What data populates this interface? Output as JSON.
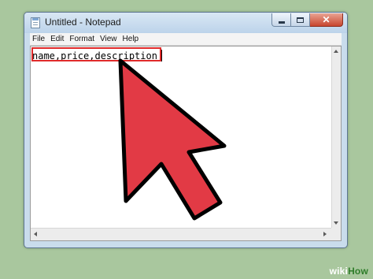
{
  "window": {
    "title": "Untitled - Notepad",
    "close_glyph": "✕"
  },
  "menu": [
    "File",
    "Edit",
    "Format",
    "View",
    "Help"
  ],
  "editor": {
    "content": "name,price,description"
  },
  "icons": {
    "app": "notepad-icon",
    "cursor": "mouse-cursor-arrow-icon"
  },
  "colors": {
    "background": "#a9c79e",
    "highlight_border": "#e02a2a",
    "cursor_fill": "#e23a45"
  },
  "watermark": {
    "part1": "wiki",
    "part2": "How"
  }
}
